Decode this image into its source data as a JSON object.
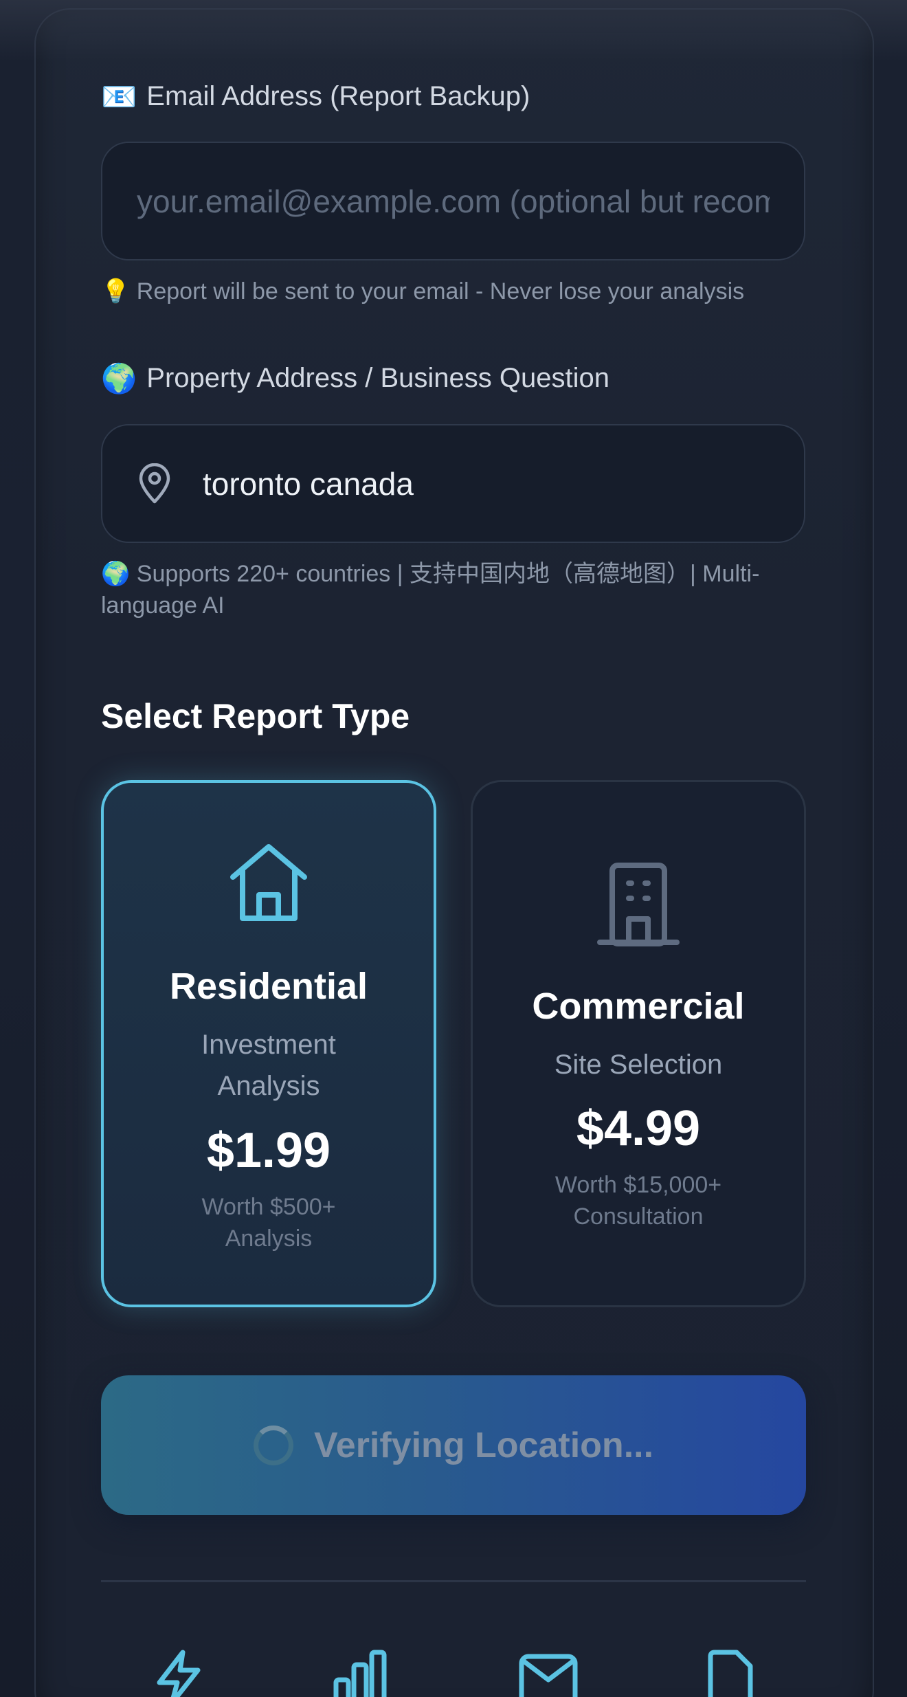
{
  "email": {
    "emoji": "📧",
    "label": "Email Address (Report Backup)",
    "placeholder": "your.email@example.com (optional but recommended)",
    "value": "",
    "hint_emoji": "💡",
    "hint": "Report will be sent to your email - Never lose your analysis"
  },
  "address": {
    "emoji": "🌍",
    "label": "Property Address / Business Question",
    "value": "toronto canada",
    "hint_line1": "🌍 Supports 220+ countries | 支持中国内地（高德地图）| Multi-",
    "hint_line2": "language AI"
  },
  "report_type": {
    "title": "Select Report Type",
    "options": [
      {
        "icon": "house-icon",
        "title": "Residential",
        "subtitle_line1": "Investment",
        "subtitle_line2": "Analysis",
        "price": "$1.99",
        "worth_line1": "Worth $500+",
        "worth_line2": "Analysis",
        "selected": true
      },
      {
        "icon": "building-icon",
        "title": "Commercial",
        "subtitle_line1": "Site Selection",
        "price": "$4.99",
        "worth_line1": "Worth $15,000+",
        "worth_line2": "Consultation",
        "selected": false
      }
    ]
  },
  "submit": {
    "label": "Verifying Location..."
  },
  "features": {
    "icons": [
      "lightning-icon",
      "bar-chart-icon",
      "mail-icon",
      "document-icon"
    ]
  },
  "colors": {
    "accent": "#5bc3e3",
    "background": "#1a2131",
    "button_start": "#2c6a86",
    "button_end": "#2547a0"
  }
}
